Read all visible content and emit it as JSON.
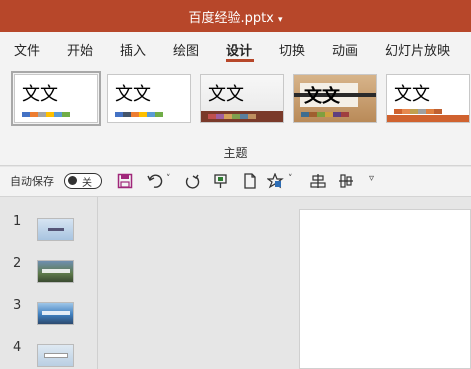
{
  "window": {
    "title": "百度经验.pptx"
  },
  "tabs": [
    "文件",
    "开始",
    "插入",
    "绘图",
    "设计",
    "切换",
    "动画",
    "幻灯片放映"
  ],
  "active_tab": "设计",
  "themes": {
    "sample_text": "文文",
    "group_label": "主题",
    "items": [
      {
        "swatches": [
          "#4472c4",
          "#ed7d31",
          "#a5a5a5",
          "#ffc000",
          "#5b9bd5",
          "#70ad47"
        ]
      },
      {
        "swatches": [
          "#4472c4",
          "#44546a",
          "#ed7d31",
          "#ffc000",
          "#5b9bd5",
          "#70ad47"
        ]
      },
      {
        "swatches": [
          "#c0504d",
          "#9f5f9f",
          "#d4a05a",
          "#7f9f4f",
          "#5a7f9f",
          "#bf8f5f"
        ]
      },
      {
        "swatches": [
          "#3f6d8f",
          "#a05f2f",
          "#7f9f3f",
          "#cf9f3f",
          "#5f3f7f",
          "#9f3f3f"
        ]
      },
      {
        "swatches": [
          "#d0622f",
          "#e6884f",
          "#c0a050",
          "#a0a0a0",
          "#e08040",
          "#c06030"
        ]
      }
    ]
  },
  "qat": {
    "autosave_label": "自动保存",
    "toggle_label": "关"
  },
  "slides": [
    "1",
    "2",
    "3",
    "4"
  ]
}
